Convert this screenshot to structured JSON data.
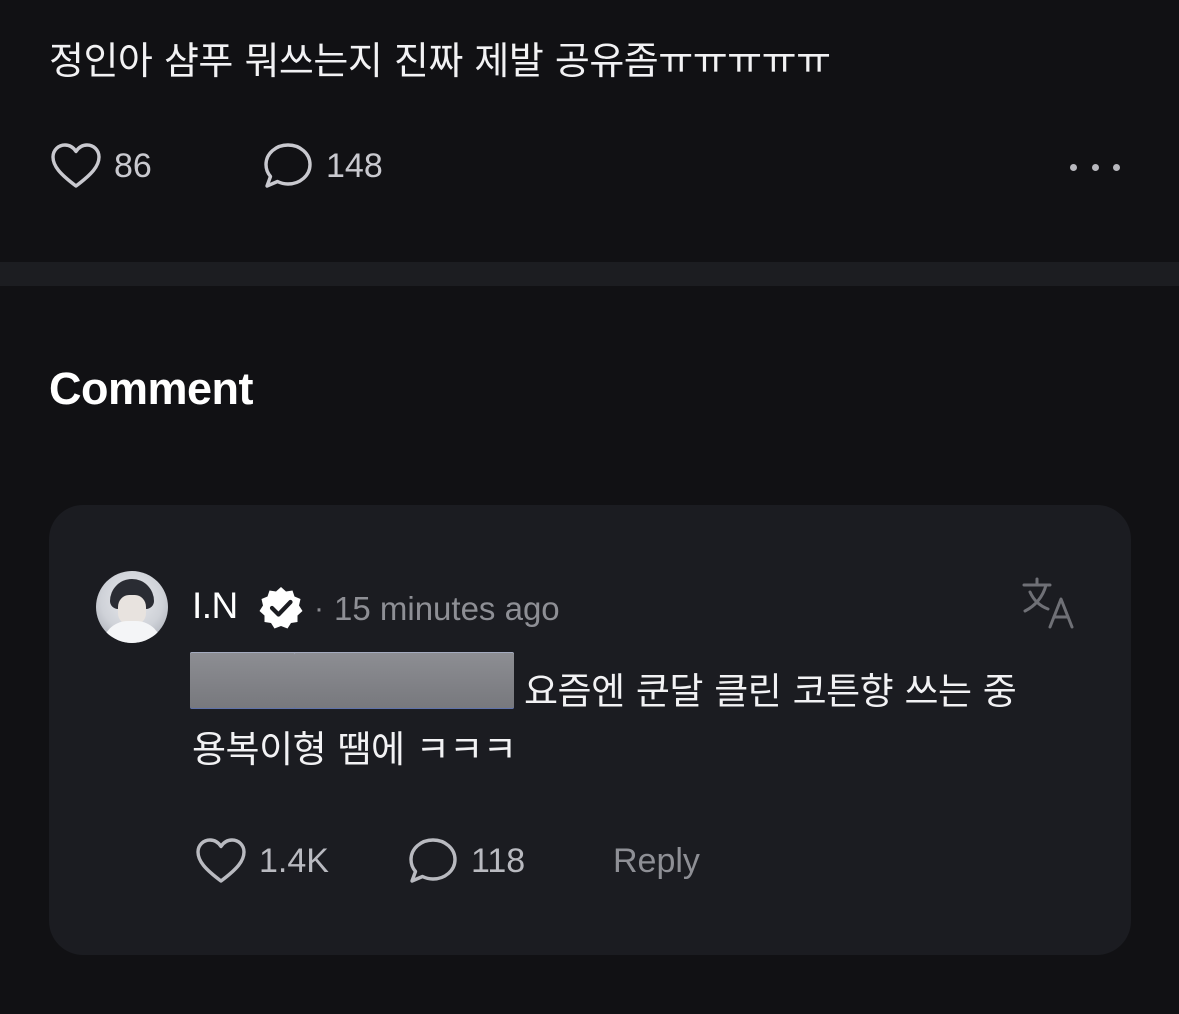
{
  "post": {
    "text": "정인아 샴푸 뭐쓰는지 진짜 제발 공유좀ㅠㅠㅠㅠㅠ",
    "likes": "86",
    "comments": "148"
  },
  "section": {
    "title": "Comment"
  },
  "comment": {
    "username": "I.N",
    "timestamp": "15 minutes ago",
    "text_line1": "요즘엔 쿤달 클린 코튼향 쓰는 중",
    "text_line2": "용복이형 땜에 ㅋㅋㅋ",
    "likes": "1.4K",
    "replies": "118",
    "reply_label": "Reply"
  },
  "icons": {
    "like": "heart-icon",
    "comment": "speech-bubble-icon",
    "more": "more-dots-icon",
    "verified": "verified-badge-icon",
    "translate": "translate-icon"
  },
  "colors": {
    "background": "#111114",
    "card": "#1b1c21",
    "divider": "#1c1d21",
    "muted_text": "#8e8f95"
  }
}
